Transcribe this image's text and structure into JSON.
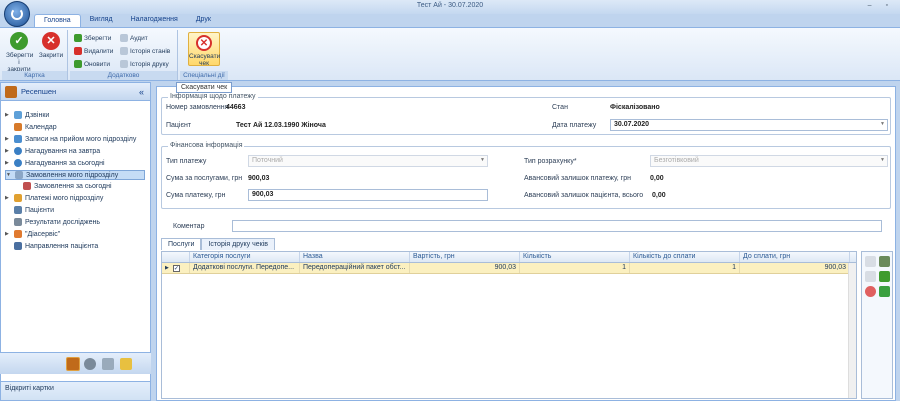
{
  "window": {
    "title": "Тест Ай - 30.07.2020",
    "buttons": "– ▫"
  },
  "tabs": [
    "Головна",
    "Вигляд",
    "Налагодження",
    "Друк"
  ],
  "ribbon": {
    "card_group": {
      "label": "Картка",
      "save_close": "Зберегти і закрити",
      "close": "Закрити"
    },
    "extra_group": {
      "label": "Додатково",
      "save": "Зберегти",
      "delete": "Видалити",
      "refresh": "Оновити",
      "audit": "Аудит",
      "state_history": "Історія станів",
      "print_history": "Історія друку"
    },
    "special_group": {
      "label": "Спеціальні дії",
      "cancel_check": "Скасувати чек"
    }
  },
  "tooltip": "Скасувати чек",
  "sidebar": {
    "title": "Ресепшен",
    "collapse": "«",
    "items": [
      {
        "label": "Дзвінки"
      },
      {
        "label": "Календар"
      },
      {
        "label": "Записи на прийом мого підрозділу"
      },
      {
        "label": "Нагадування на завтра"
      },
      {
        "label": "Нагадування за сьогодні"
      },
      {
        "label": "Замовлення мого підрозділу"
      },
      {
        "label": "Замовлення за сьогодні"
      },
      {
        "label": "Платежі мого підрозділу"
      },
      {
        "label": "Пацієнти"
      },
      {
        "label": "Результати досліджень"
      },
      {
        "label": "\"Діасервіс\""
      },
      {
        "label": "Направлення пацієнта"
      }
    ],
    "open_cards": "Відкриті картки"
  },
  "payment_info": {
    "legend": "Інформація щодо платежу",
    "order_no_label": "Номер замовлення",
    "order_no": "44663",
    "patient_label": "Пацієнт",
    "patient": "Тест Ай  12.03.1990 Жіноча",
    "state_label": "Стан",
    "state": "Фіскалізовано",
    "date_label": "Дата платежу",
    "date": "30.07.2020"
  },
  "finance": {
    "legend": "Фінансова інформація",
    "pay_type_label": "Тип платежу",
    "pay_type": "Поточний",
    "calc_type_label": "Тип розрахунку*",
    "calc_type": "Безготівковий",
    "services_sum_label": "Сума за послугами, грн",
    "services_sum": "900,03",
    "advance_payment_label": "Авансовий залишок платежу, грн",
    "advance_payment": "0,00",
    "payment_sum_label": "Сума платежу, грн",
    "payment_sum": "900,03",
    "advance_patient_label": "Авансовий залишок пацієнта, всього",
    "advance_patient": "0,00"
  },
  "comment": {
    "label": "Коментар",
    "value": ""
  },
  "detail_tabs": [
    "Послуги",
    "Історія друку чеків"
  ],
  "grid": {
    "columns": [
      "Категорія послуги",
      "Назва",
      "Вартість, грн",
      "Кількість",
      "Кількість до сплати",
      "До сплати, грн"
    ],
    "rows": [
      {
        "category": "Додаткові послуги. Передопе...",
        "name": "Передопераційний пакет обст...",
        "price": "900,03",
        "qty": "1",
        "qty_to_pay": "1",
        "to_pay": "900,03",
        "checked": "✓"
      }
    ]
  }
}
